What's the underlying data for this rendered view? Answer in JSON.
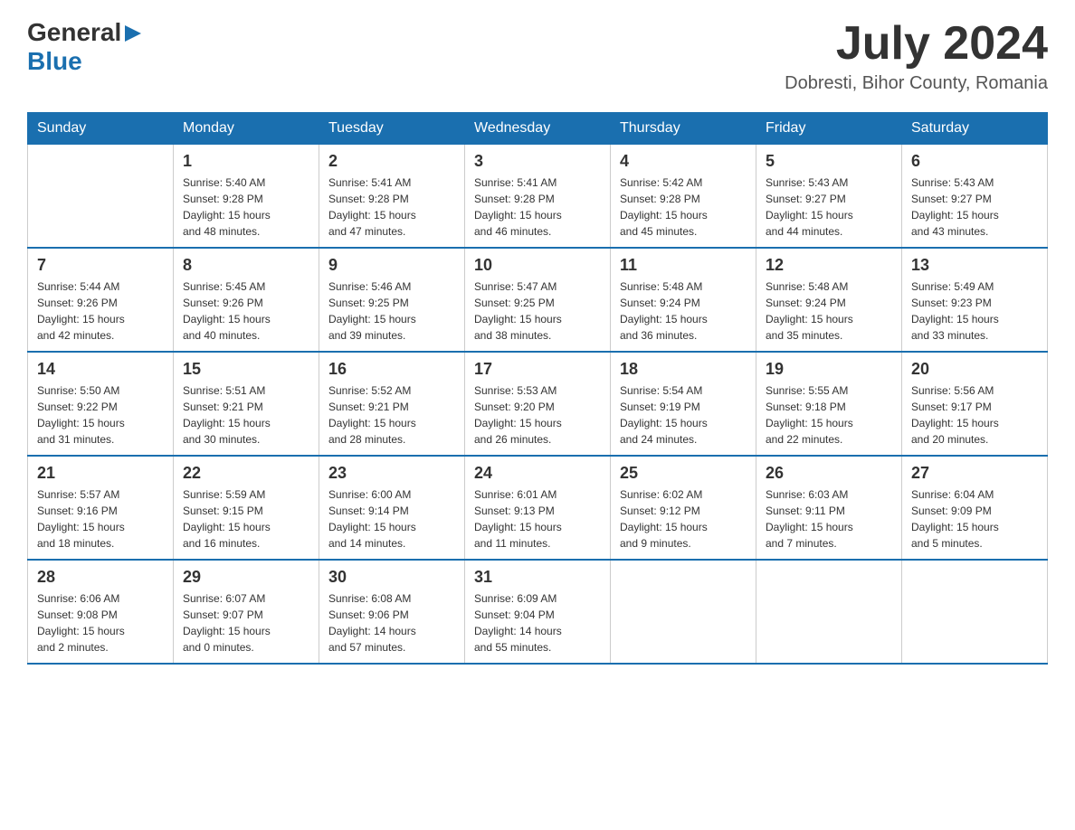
{
  "header": {
    "logo_general": "General",
    "logo_blue": "Blue",
    "month_year": "July 2024",
    "location": "Dobresti, Bihor County, Romania"
  },
  "weekdays": [
    "Sunday",
    "Monday",
    "Tuesday",
    "Wednesday",
    "Thursday",
    "Friday",
    "Saturday"
  ],
  "weeks": [
    [
      {
        "day": "",
        "info": ""
      },
      {
        "day": "1",
        "info": "Sunrise: 5:40 AM\nSunset: 9:28 PM\nDaylight: 15 hours\nand 48 minutes."
      },
      {
        "day": "2",
        "info": "Sunrise: 5:41 AM\nSunset: 9:28 PM\nDaylight: 15 hours\nand 47 minutes."
      },
      {
        "day": "3",
        "info": "Sunrise: 5:41 AM\nSunset: 9:28 PM\nDaylight: 15 hours\nand 46 minutes."
      },
      {
        "day": "4",
        "info": "Sunrise: 5:42 AM\nSunset: 9:28 PM\nDaylight: 15 hours\nand 45 minutes."
      },
      {
        "day": "5",
        "info": "Sunrise: 5:43 AM\nSunset: 9:27 PM\nDaylight: 15 hours\nand 44 minutes."
      },
      {
        "day": "6",
        "info": "Sunrise: 5:43 AM\nSunset: 9:27 PM\nDaylight: 15 hours\nand 43 minutes."
      }
    ],
    [
      {
        "day": "7",
        "info": "Sunrise: 5:44 AM\nSunset: 9:26 PM\nDaylight: 15 hours\nand 42 minutes."
      },
      {
        "day": "8",
        "info": "Sunrise: 5:45 AM\nSunset: 9:26 PM\nDaylight: 15 hours\nand 40 minutes."
      },
      {
        "day": "9",
        "info": "Sunrise: 5:46 AM\nSunset: 9:25 PM\nDaylight: 15 hours\nand 39 minutes."
      },
      {
        "day": "10",
        "info": "Sunrise: 5:47 AM\nSunset: 9:25 PM\nDaylight: 15 hours\nand 38 minutes."
      },
      {
        "day": "11",
        "info": "Sunrise: 5:48 AM\nSunset: 9:24 PM\nDaylight: 15 hours\nand 36 minutes."
      },
      {
        "day": "12",
        "info": "Sunrise: 5:48 AM\nSunset: 9:24 PM\nDaylight: 15 hours\nand 35 minutes."
      },
      {
        "day": "13",
        "info": "Sunrise: 5:49 AM\nSunset: 9:23 PM\nDaylight: 15 hours\nand 33 minutes."
      }
    ],
    [
      {
        "day": "14",
        "info": "Sunrise: 5:50 AM\nSunset: 9:22 PM\nDaylight: 15 hours\nand 31 minutes."
      },
      {
        "day": "15",
        "info": "Sunrise: 5:51 AM\nSunset: 9:21 PM\nDaylight: 15 hours\nand 30 minutes."
      },
      {
        "day": "16",
        "info": "Sunrise: 5:52 AM\nSunset: 9:21 PM\nDaylight: 15 hours\nand 28 minutes."
      },
      {
        "day": "17",
        "info": "Sunrise: 5:53 AM\nSunset: 9:20 PM\nDaylight: 15 hours\nand 26 minutes."
      },
      {
        "day": "18",
        "info": "Sunrise: 5:54 AM\nSunset: 9:19 PM\nDaylight: 15 hours\nand 24 minutes."
      },
      {
        "day": "19",
        "info": "Sunrise: 5:55 AM\nSunset: 9:18 PM\nDaylight: 15 hours\nand 22 minutes."
      },
      {
        "day": "20",
        "info": "Sunrise: 5:56 AM\nSunset: 9:17 PM\nDaylight: 15 hours\nand 20 minutes."
      }
    ],
    [
      {
        "day": "21",
        "info": "Sunrise: 5:57 AM\nSunset: 9:16 PM\nDaylight: 15 hours\nand 18 minutes."
      },
      {
        "day": "22",
        "info": "Sunrise: 5:59 AM\nSunset: 9:15 PM\nDaylight: 15 hours\nand 16 minutes."
      },
      {
        "day": "23",
        "info": "Sunrise: 6:00 AM\nSunset: 9:14 PM\nDaylight: 15 hours\nand 14 minutes."
      },
      {
        "day": "24",
        "info": "Sunrise: 6:01 AM\nSunset: 9:13 PM\nDaylight: 15 hours\nand 11 minutes."
      },
      {
        "day": "25",
        "info": "Sunrise: 6:02 AM\nSunset: 9:12 PM\nDaylight: 15 hours\nand 9 minutes."
      },
      {
        "day": "26",
        "info": "Sunrise: 6:03 AM\nSunset: 9:11 PM\nDaylight: 15 hours\nand 7 minutes."
      },
      {
        "day": "27",
        "info": "Sunrise: 6:04 AM\nSunset: 9:09 PM\nDaylight: 15 hours\nand 5 minutes."
      }
    ],
    [
      {
        "day": "28",
        "info": "Sunrise: 6:06 AM\nSunset: 9:08 PM\nDaylight: 15 hours\nand 2 minutes."
      },
      {
        "day": "29",
        "info": "Sunrise: 6:07 AM\nSunset: 9:07 PM\nDaylight: 15 hours\nand 0 minutes."
      },
      {
        "day": "30",
        "info": "Sunrise: 6:08 AM\nSunset: 9:06 PM\nDaylight: 14 hours\nand 57 minutes."
      },
      {
        "day": "31",
        "info": "Sunrise: 6:09 AM\nSunset: 9:04 PM\nDaylight: 14 hours\nand 55 minutes."
      },
      {
        "day": "",
        "info": ""
      },
      {
        "day": "",
        "info": ""
      },
      {
        "day": "",
        "info": ""
      }
    ]
  ]
}
